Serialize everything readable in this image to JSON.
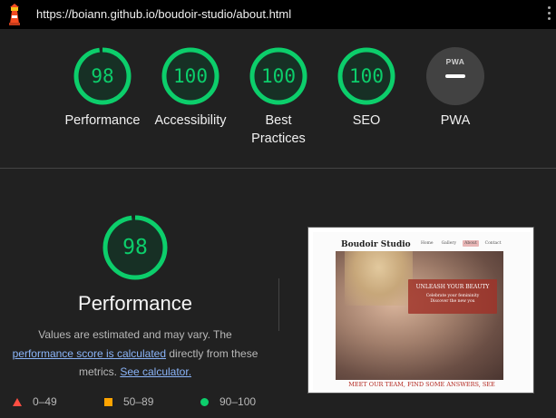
{
  "browser": {
    "url": "https://boiann.github.io/boudoir-studio/about.html",
    "logo_icon": "lighthouse-icon",
    "menu_icon": "kebab-menu-icon"
  },
  "summary_gauges": [
    {
      "score": "98",
      "label": "Performance",
      "color": "#0cce6b"
    },
    {
      "score": "100",
      "label": "Accessibility",
      "color": "#0cce6b"
    },
    {
      "score": "100",
      "label": "Best Practices",
      "color": "#0cce6b"
    },
    {
      "score": "100",
      "label": "SEO",
      "color": "#0cce6b"
    },
    {
      "label": "PWA",
      "badge": "PWA",
      "color": "#9e9e9e"
    }
  ],
  "performance": {
    "score": "98",
    "score_fraction": 0.98,
    "title": "Performance",
    "desc_before": "Values are estimated and may vary. The ",
    "desc_link": "performance score is calculated",
    "desc_middle": " directly from these metrics. ",
    "desc_link2": "See calculator.",
    "legend": [
      {
        "shape": "triangle",
        "range": "0–49",
        "color": "#ff4e42"
      },
      {
        "shape": "square",
        "range": "50–89",
        "color": "#ffa400"
      },
      {
        "shape": "circle",
        "range": "90–100",
        "color": "#0cce6b"
      }
    ]
  },
  "screenshot": {
    "brand": "Boudoir Studio",
    "nav": [
      "Home",
      "Gallery",
      "About",
      "Contact"
    ],
    "active_nav": "About",
    "hero_title": "UNLEASH YOUR BEAUTY",
    "hero_line1": "Celebrate your femininity",
    "hero_line2": "Discover the new you",
    "footer": "MEET OUR TEAM, FIND SOME ANSWERS, SEE"
  }
}
